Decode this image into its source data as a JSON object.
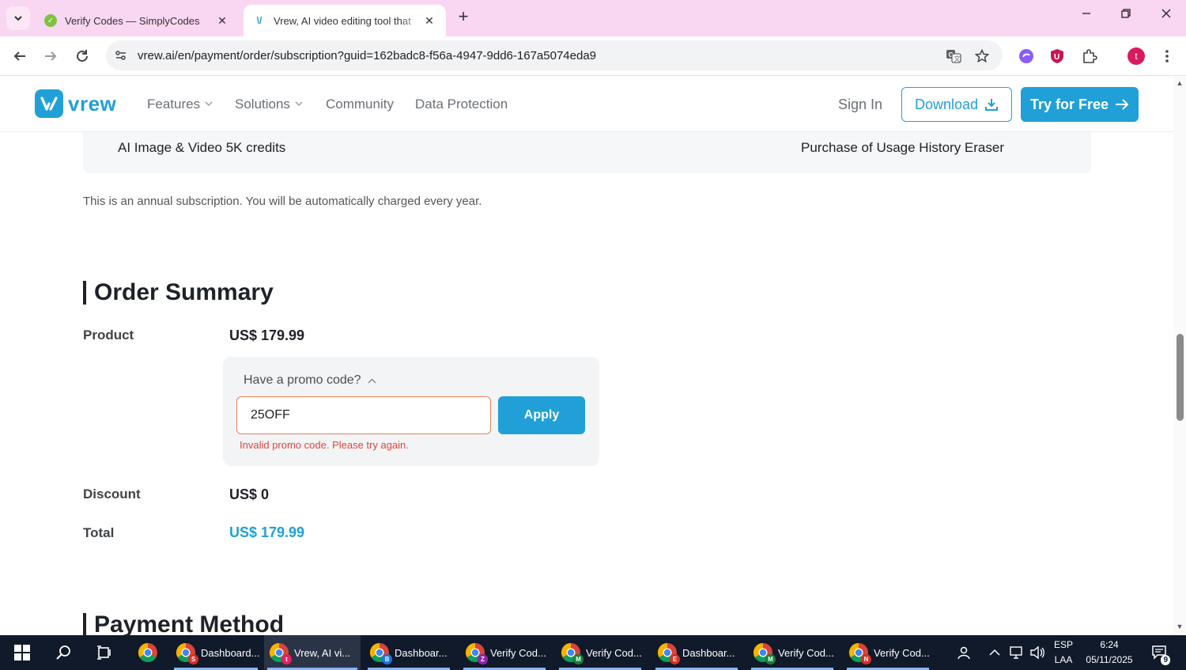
{
  "browser": {
    "tabs": [
      {
        "title": "Verify Codes — SimplyCodes",
        "active": false
      },
      {
        "title": "Vrew, AI video editing tool that",
        "active": true
      }
    ],
    "url": "vrew.ai/en/payment/order/subscription?guid=162badc8-f56a-4947-9dd6-167a5074eda9",
    "profile_initial": "t"
  },
  "site": {
    "logo_text": "vrew",
    "nav": [
      "Features",
      "Solutions",
      "Community",
      "Data Protection"
    ],
    "sign_in": "Sign In",
    "download": "Download",
    "try_free": "Try for Free"
  },
  "plan": {
    "benefit_left": "AI Image & Video 5K credits",
    "benefit_right": "Purchase of Usage History Eraser",
    "note": "This is an annual subscription. You will be automatically charged every year."
  },
  "order_summary": {
    "title": "Order Summary",
    "product_label": "Product",
    "product_value": "US$ 179.99",
    "promo": {
      "toggle_label": "Have a promo code?",
      "code_value": "25OFF",
      "apply_label": "Apply",
      "error": "Invalid promo code. Please try again."
    },
    "discount_label": "Discount",
    "discount_value": "US$ 0",
    "total_label": "Total",
    "total_value": "US$ 179.99"
  },
  "payment": {
    "title": "Payment Method"
  },
  "taskbar": {
    "apps": [
      {
        "label": "Dashboard...",
        "badge": "S",
        "badge_color": "#d93025",
        "active": false
      },
      {
        "label": "Vrew, AI vi...",
        "badge": "t",
        "badge_color": "#e91e63",
        "active": true
      },
      {
        "label": "Dashboar...",
        "badge": "B",
        "badge_color": "#1a73e8",
        "active": false
      },
      {
        "label": "Verify Cod...",
        "badge": "Z",
        "badge_color": "#8e24aa",
        "active": false
      },
      {
        "label": "Verify Cod...",
        "badge": "M",
        "badge_color": "#188038",
        "active": false
      },
      {
        "label": "Dashboar...",
        "badge": "E",
        "badge_color": "#d93025",
        "active": false
      },
      {
        "label": "Verify Cod...",
        "badge": "M",
        "badge_color": "#188038",
        "active": false
      },
      {
        "label": "Verify Cod...",
        "badge": "N",
        "badge_color": "#d93025",
        "active": false
      }
    ],
    "lang_top": "ESP",
    "lang_bottom": "LAA",
    "time": "6:24",
    "date": "05/11/2025",
    "notification_count": "9"
  },
  "colors": {
    "accent": "#20a0d6",
    "tabbar": "#f9d6f1",
    "error": "#e2453c",
    "taskbar": "#101a2b"
  }
}
